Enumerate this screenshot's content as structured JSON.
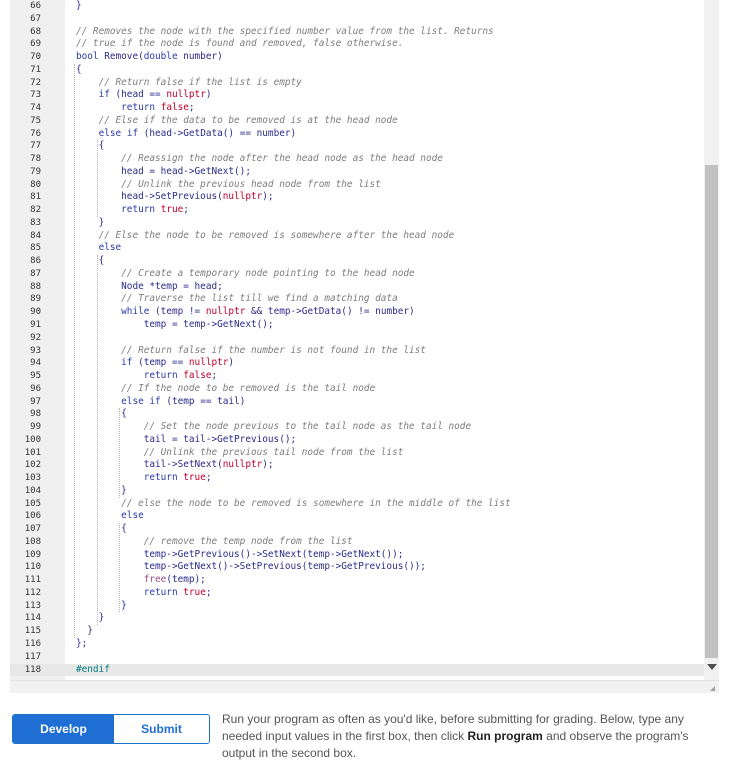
{
  "editor": {
    "lines": [
      {
        "n": "66",
        "t": "}",
        "cls": ""
      },
      {
        "n": "67",
        "t": "",
        "cls": ""
      },
      {
        "n": "68",
        "t": "// Removes the node with the specified number value from the list. Returns",
        "cls": "c"
      },
      {
        "n": "69",
        "t": "// true if the node is found and removed, false otherwise.",
        "cls": "c"
      },
      {
        "n": "70",
        "t": "bool Remove(double number)",
        "cls": ""
      },
      {
        "n": "71",
        "t": "{",
        "cls": ""
      },
      {
        "n": "72",
        "t": "    // Return false if the list is empty",
        "cls": "c"
      },
      {
        "n": "73",
        "t": "    if (head == nullptr)",
        "cls": ""
      },
      {
        "n": "74",
        "t": "        return false;",
        "cls": ""
      },
      {
        "n": "75",
        "t": "    // Else if the data to be removed is at the head node",
        "cls": "c"
      },
      {
        "n": "76",
        "t": "    else if (head->GetData() == number)",
        "cls": ""
      },
      {
        "n": "77",
        "t": "    {",
        "cls": ""
      },
      {
        "n": "78",
        "t": "        // Reassign the node after the head node as the head node",
        "cls": "c"
      },
      {
        "n": "79",
        "t": "        head = head->GetNext();",
        "cls": ""
      },
      {
        "n": "80",
        "t": "        // Unlink the previous head node from the list",
        "cls": "c"
      },
      {
        "n": "81",
        "t": "        head->SetPrevious(nullptr);",
        "cls": ""
      },
      {
        "n": "82",
        "t": "        return true;",
        "cls": ""
      },
      {
        "n": "83",
        "t": "    }",
        "cls": ""
      },
      {
        "n": "84",
        "t": "    // Else the node to be removed is somewhere after the head node",
        "cls": "c"
      },
      {
        "n": "85",
        "t": "    else",
        "cls": ""
      },
      {
        "n": "86",
        "t": "    {",
        "cls": ""
      },
      {
        "n": "87",
        "t": "        // Create a temporary node pointing to the head node",
        "cls": "c"
      },
      {
        "n": "88",
        "t": "        Node *temp = head;",
        "cls": ""
      },
      {
        "n": "89",
        "t": "        // Traverse the list till we find a matching data",
        "cls": "c"
      },
      {
        "n": "90",
        "t": "        while (temp != nullptr && temp->GetData() != number)",
        "cls": ""
      },
      {
        "n": "91",
        "t": "            temp = temp->GetNext();",
        "cls": ""
      },
      {
        "n": "92",
        "t": "",
        "cls": ""
      },
      {
        "n": "93",
        "t": "        // Return false if the number is not found in the list",
        "cls": "c"
      },
      {
        "n": "94",
        "t": "        if (temp == nullptr)",
        "cls": ""
      },
      {
        "n": "95",
        "t": "            return false;",
        "cls": ""
      },
      {
        "n": "96",
        "t": "        // If the node to be removed is the tail node",
        "cls": "c"
      },
      {
        "n": "97",
        "t": "        else if (temp == tail)",
        "cls": ""
      },
      {
        "n": "98",
        "t": "        {",
        "cls": ""
      },
      {
        "n": "99",
        "t": "            // Set the node previous to the tail node as the tail node",
        "cls": "c"
      },
      {
        "n": "100",
        "t": "            tail = tail->GetPrevious();",
        "cls": ""
      },
      {
        "n": "101",
        "t": "            // Unlink the previous tail node from the list",
        "cls": "c"
      },
      {
        "n": "102",
        "t": "            tail->SetNext(nullptr);",
        "cls": ""
      },
      {
        "n": "103",
        "t": "            return true;",
        "cls": ""
      },
      {
        "n": "104",
        "t": "        }",
        "cls": ""
      },
      {
        "n": "105",
        "t": "        // else the node to be removed is somewhere in the middle of the list",
        "cls": "c"
      },
      {
        "n": "106",
        "t": "        else",
        "cls": ""
      },
      {
        "n": "107",
        "t": "        {",
        "cls": ""
      },
      {
        "n": "108",
        "t": "            // remove the temp node from the list",
        "cls": "c"
      },
      {
        "n": "109",
        "t": "            temp->GetPrevious()->SetNext(temp->GetNext());",
        "cls": ""
      },
      {
        "n": "110",
        "t": "            temp->GetNext()->SetPrevious(temp->GetPrevious());",
        "cls": ""
      },
      {
        "n": "111",
        "t": "            free(temp);",
        "cls": ""
      },
      {
        "n": "112",
        "t": "            return true;",
        "cls": ""
      },
      {
        "n": "113",
        "t": "        }",
        "cls": ""
      },
      {
        "n": "114",
        "t": "    }",
        "cls": ""
      },
      {
        "n": "115",
        "t": "  }",
        "cls": ""
      },
      {
        "n": "116",
        "t": "};",
        "cls": ""
      },
      {
        "n": "117",
        "t": "",
        "cls": ""
      },
      {
        "n": "118",
        "t": "#endif",
        "cls": "p"
      }
    ],
    "active_line": "118"
  },
  "mode_toggle": {
    "develop_label": "Develop mode",
    "submit_label": "Submit mode",
    "selected": "Develop mode"
  },
  "instructions": {
    "before": "Run your program as often as you'd like, before submitting for grading. Below, type any needed input values in the first box, then click ",
    "emphasis": "Run program",
    "after": " and observe the program's output in the second box."
  },
  "colors": {
    "accent": "#1e6ed4",
    "comment": "#7d7d7d",
    "keyword": "#2a3aa8",
    "literal": "#c0002a"
  }
}
